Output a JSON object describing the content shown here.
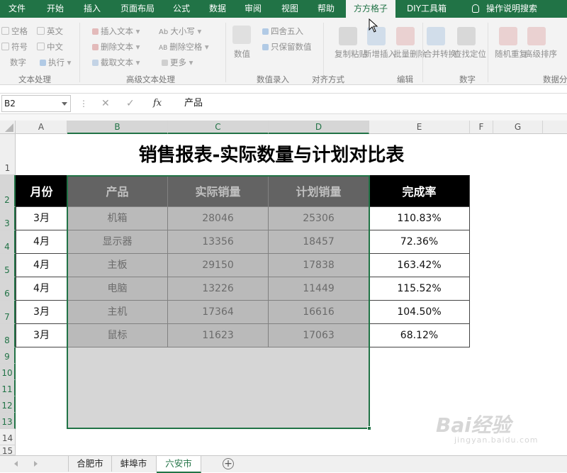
{
  "ribbon": {
    "tabs": [
      "文件",
      "开始",
      "插入",
      "页面布局",
      "公式",
      "数据",
      "审阅",
      "视图",
      "帮助",
      "方方格子",
      "DIY工具箱",
      "操作说明搜索"
    ],
    "active_tab": "方方格子",
    "controls": {
      "space": "空格",
      "english": "英文",
      "symbol": "符号",
      "chinese": "中文",
      "number": "数字",
      "execute": "执行",
      "insert_text": "插入文本",
      "case": "大小写",
      "delete_text": "删除文本",
      "delete_space": "删除空格",
      "extract_text": "截取文本",
      "more": "更多",
      "numeric": "数值",
      "round": "四舍五入",
      "keep_value": "只保留数值",
      "copy_paste": "复制粘贴",
      "new_insert": "新增插入",
      "batch_delete": "批量删除",
      "merge_convert": "合并转换",
      "find_locate": "查找定位",
      "random_repeat": "随机重复",
      "advanced_sort": "高级排序"
    },
    "groups": [
      "文本处理",
      "高级文本处理",
      "数值录入",
      "对齐方式",
      "编辑",
      "数字",
      "数据分"
    ]
  },
  "formula_bar": {
    "name_box": "B2",
    "cancel": "✕",
    "enter": "✓",
    "fx": "fx",
    "content": "产品"
  },
  "columns": [
    "A",
    "B",
    "C",
    "D",
    "E",
    "F",
    "G"
  ],
  "rows": [
    "1",
    "2",
    "3",
    "4",
    "5",
    "6",
    "7",
    "8",
    "9",
    "10",
    "11",
    "12",
    "13",
    "14",
    "15"
  ],
  "sheet": {
    "title": "销售报表-实际数量与计划对比表",
    "headers": [
      "月份",
      "产品",
      "实际销量",
      "计划销量",
      "完成率"
    ],
    "data": [
      [
        "3月",
        "机箱",
        "28046",
        "25306",
        "110.83%"
      ],
      [
        "4月",
        "显示器",
        "13356",
        "18457",
        "72.36%"
      ],
      [
        "4月",
        "主板",
        "29150",
        "17838",
        "163.42%"
      ],
      [
        "4月",
        "电脑",
        "13226",
        "11449",
        "115.52%"
      ],
      [
        "3月",
        "主机",
        "17364",
        "16616",
        "104.50%"
      ],
      [
        "3月",
        "鼠标",
        "11623",
        "17063",
        "68.12%"
      ]
    ]
  },
  "sheet_tabs": [
    "合肥市",
    "蚌埠市",
    "六安市"
  ],
  "active_sheet": "六安市",
  "add_sheet": "+",
  "watermark": {
    "brand": "Bai经验",
    "url": "jingyan.baidu.com"
  },
  "colors": {
    "excel_green": "#217346",
    "header_bg": "#000000",
    "selection": "#c0c0c0"
  }
}
